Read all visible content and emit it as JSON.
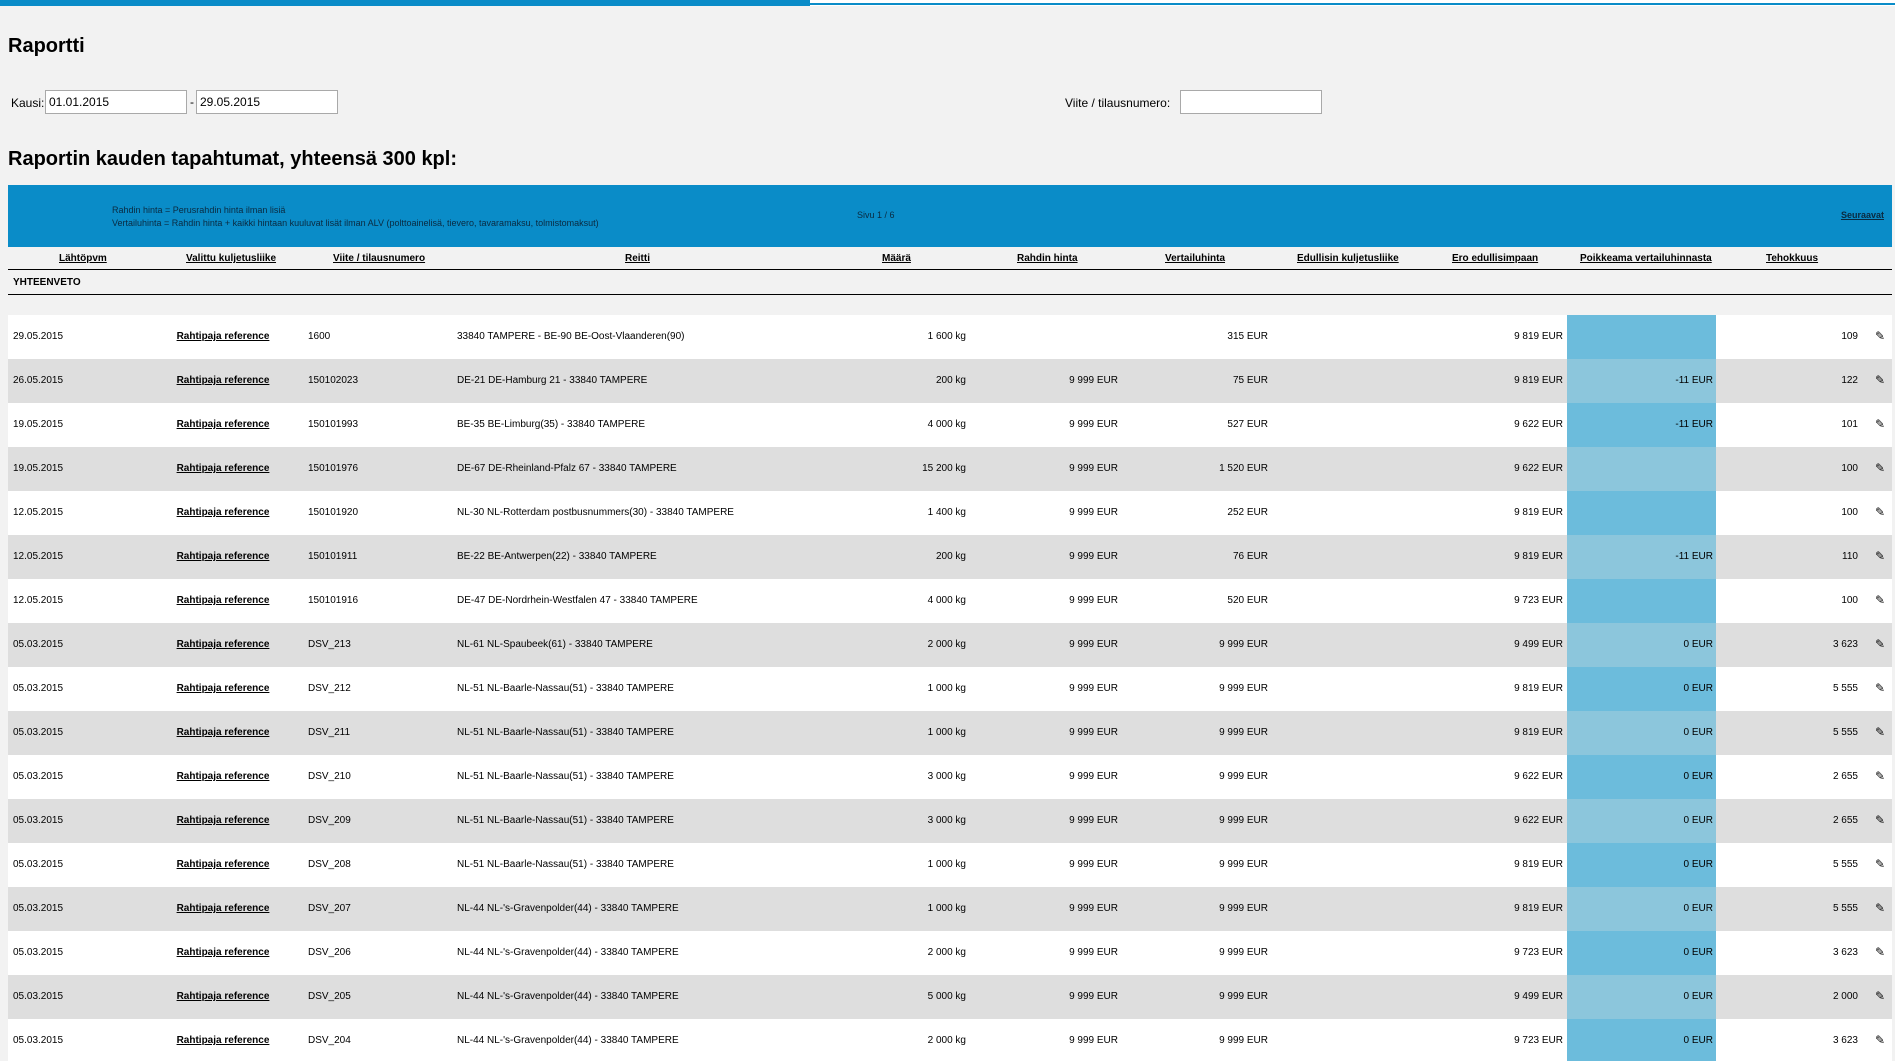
{
  "page": {
    "title": "Raportti",
    "period_label": "Kausi:",
    "date_from": "01.01.2015",
    "date_separator": "-",
    "date_to": "29.05.2015",
    "reference_label": "Viite / tilausnumero:",
    "reference_value": "",
    "subtitle": "Raportin kauden tapahtumat, yhteensä 300 kpl:"
  },
  "banner": {
    "note_line1": "Rahdin hinta = Perusrahdin hinta ilman lisiä",
    "note_line2": "Vertailuhinta = Rahdin hinta + kaikki hintaan kuuluvat lisät ilman ALV (polttoainelisä, tievero, tavaramaksu, tolmistomaksut)",
    "page_info": "Sivu 1 / 6",
    "next_label": "Seuraavat"
  },
  "columns": {
    "date": "Lähtöpvm",
    "carrier": "Valittu kuljetusliike",
    "reference": "Viite / tilausnumero",
    "route": "Reitti",
    "amount": "Määrä",
    "freight_price": "Rahdin hinta",
    "compare_price": "Vertailuhinta",
    "cheapest_carrier": "Edullisin kuljetusliike",
    "diff_cheapest": "Ero edullisimpaan",
    "deviation": "Poikkeama vertailuhinnasta",
    "efficiency": "Tehokkuus"
  },
  "summary_label": "YHTEENVETO",
  "colors": {
    "accent": "#0a8cc8",
    "deviation_odd": "#6cbcdc",
    "deviation_even": "#8cc6dc"
  },
  "icons": {
    "edit": "pencil-icon"
  },
  "rows": [
    {
      "date": "29.05.2015",
      "carrier": "Rahtipaja reference",
      "ref": "1600",
      "route": "33840 TAMPERE - BE-90 BE-Oost-Vlaanderen(90)",
      "amount": "1 600 kg",
      "price": "",
      "compare": "315 EUR",
      "cheapest": "9 819 EUR",
      "deviation": "",
      "efficiency": "109"
    },
    {
      "date": "26.05.2015",
      "carrier": "Rahtipaja reference",
      "ref": "150102023",
      "route": "DE-21 DE-Hamburg 21 - 33840 TAMPERE",
      "amount": "200 kg",
      "price": "9 999 EUR",
      "compare": "75 EUR",
      "cheapest": "9 819 EUR",
      "deviation": "-11 EUR",
      "efficiency": "122"
    },
    {
      "date": "19.05.2015",
      "carrier": "Rahtipaja reference",
      "ref": "150101993",
      "route": "BE-35 BE-Limburg(35) - 33840 TAMPERE",
      "amount": "4 000 kg",
      "price": "9 999 EUR",
      "compare": "527 EUR",
      "cheapest": "9 622 EUR",
      "deviation": "-11 EUR",
      "efficiency": "101"
    },
    {
      "date": "19.05.2015",
      "carrier": "Rahtipaja reference",
      "ref": "150101976",
      "route": "DE-67 DE-Rheinland-Pfalz 67 - 33840 TAMPERE",
      "amount": "15 200 kg",
      "price": "9 999 EUR",
      "compare": "1 520 EUR",
      "cheapest": "9 622 EUR",
      "deviation": "",
      "efficiency": "100"
    },
    {
      "date": "12.05.2015",
      "carrier": "Rahtipaja reference",
      "ref": "150101920",
      "route": "NL-30 NL-Rotterdam postbusnummers(30) - 33840 TAMPERE",
      "amount": "1 400 kg",
      "price": "9 999 EUR",
      "compare": "252 EUR",
      "cheapest": "9 819 EUR",
      "deviation": "",
      "efficiency": "100"
    },
    {
      "date": "12.05.2015",
      "carrier": "Rahtipaja reference",
      "ref": "150101911",
      "route": "BE-22 BE-Antwerpen(22) - 33840 TAMPERE",
      "amount": "200 kg",
      "price": "9 999 EUR",
      "compare": "76 EUR",
      "cheapest": "9 819 EUR",
      "deviation": "-11 EUR",
      "efficiency": "110"
    },
    {
      "date": "12.05.2015",
      "carrier": "Rahtipaja reference",
      "ref": "150101916",
      "route": "DE-47 DE-Nordrhein-Westfalen 47 - 33840 TAMPERE",
      "amount": "4 000 kg",
      "price": "9 999 EUR",
      "compare": "520 EUR",
      "cheapest": "9 723 EUR",
      "deviation": "",
      "efficiency": "100"
    },
    {
      "date": "05.03.2015",
      "carrier": "Rahtipaja reference",
      "ref": "DSV_213",
      "route": "NL-61 NL-Spaubeek(61) - 33840 TAMPERE",
      "amount": "2 000 kg",
      "price": "9 999 EUR",
      "compare": "9 999 EUR",
      "cheapest": "9 499 EUR",
      "deviation": "0 EUR",
      "efficiency": "3 623"
    },
    {
      "date": "05.03.2015",
      "carrier": "Rahtipaja reference",
      "ref": "DSV_212",
      "route": "NL-51 NL-Baarle-Nassau(51) - 33840 TAMPERE",
      "amount": "1 000 kg",
      "price": "9 999 EUR",
      "compare": "9 999 EUR",
      "cheapest": "9 819 EUR",
      "deviation": "0 EUR",
      "efficiency": "5 555"
    },
    {
      "date": "05.03.2015",
      "carrier": "Rahtipaja reference",
      "ref": "DSV_211",
      "route": "NL-51 NL-Baarle-Nassau(51) - 33840 TAMPERE",
      "amount": "1 000 kg",
      "price": "9 999 EUR",
      "compare": "9 999 EUR",
      "cheapest": "9 819 EUR",
      "deviation": "0 EUR",
      "efficiency": "5 555"
    },
    {
      "date": "05.03.2015",
      "carrier": "Rahtipaja reference",
      "ref": "DSV_210",
      "route": "NL-51 NL-Baarle-Nassau(51) - 33840 TAMPERE",
      "amount": "3 000 kg",
      "price": "9 999 EUR",
      "compare": "9 999 EUR",
      "cheapest": "9 622 EUR",
      "deviation": "0 EUR",
      "efficiency": "2 655"
    },
    {
      "date": "05.03.2015",
      "carrier": "Rahtipaja reference",
      "ref": "DSV_209",
      "route": "NL-51 NL-Baarle-Nassau(51) - 33840 TAMPERE",
      "amount": "3 000 kg",
      "price": "9 999 EUR",
      "compare": "9 999 EUR",
      "cheapest": "9 622 EUR",
      "deviation": "0 EUR",
      "efficiency": "2 655"
    },
    {
      "date": "05.03.2015",
      "carrier": "Rahtipaja reference",
      "ref": "DSV_208",
      "route": "NL-51 NL-Baarle-Nassau(51) - 33840 TAMPERE",
      "amount": "1 000 kg",
      "price": "9 999 EUR",
      "compare": "9 999 EUR",
      "cheapest": "9 819 EUR",
      "deviation": "0 EUR",
      "efficiency": "5 555"
    },
    {
      "date": "05.03.2015",
      "carrier": "Rahtipaja reference",
      "ref": "DSV_207",
      "route": "NL-44 NL-'s-Gravenpolder(44) - 33840 TAMPERE",
      "amount": "1 000 kg",
      "price": "9 999 EUR",
      "compare": "9 999 EUR",
      "cheapest": "9 819 EUR",
      "deviation": "0 EUR",
      "efficiency": "5 555"
    },
    {
      "date": "05.03.2015",
      "carrier": "Rahtipaja reference",
      "ref": "DSV_206",
      "route": "NL-44 NL-'s-Gravenpolder(44) - 33840 TAMPERE",
      "amount": "2 000 kg",
      "price": "9 999 EUR",
      "compare": "9 999 EUR",
      "cheapest": "9 723 EUR",
      "deviation": "0 EUR",
      "efficiency": "3 623"
    },
    {
      "date": "05.03.2015",
      "carrier": "Rahtipaja reference",
      "ref": "DSV_205",
      "route": "NL-44 NL-'s-Gravenpolder(44) - 33840 TAMPERE",
      "amount": "5 000 kg",
      "price": "9 999 EUR",
      "compare": "9 999 EUR",
      "cheapest": "9 499 EUR",
      "deviation": "0 EUR",
      "efficiency": "2 000"
    },
    {
      "date": "05.03.2015",
      "carrier": "Rahtipaja reference",
      "ref": "DSV_204",
      "route": "NL-44 NL-'s-Gravenpolder(44) - 33840 TAMPERE",
      "amount": "2 000 kg",
      "price": "9 999 EUR",
      "compare": "9 999 EUR",
      "cheapest": "9 723 EUR",
      "deviation": "0 EUR",
      "efficiency": "3 623"
    }
  ]
}
